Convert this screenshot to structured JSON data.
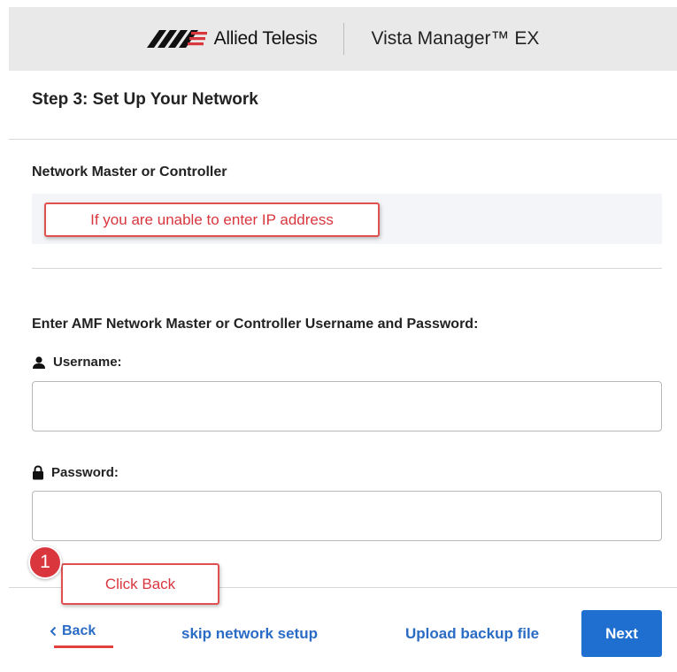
{
  "header": {
    "brand_name": "Allied Telesis",
    "product_name": "Vista Manager™ EX",
    "logo_icon": "allied-telesis-logo"
  },
  "page": {
    "step_title": "Step 3: Set Up Your Network"
  },
  "network_master": {
    "label": "Network Master or Controller"
  },
  "annotations": {
    "ip_note": "If you are unable to enter IP address",
    "click_back": "Click Back",
    "step_number": "1"
  },
  "credentials": {
    "heading": "Enter AMF Network Master or Controller Username and Password:",
    "username": {
      "label": "Username:",
      "icon": "user-icon",
      "value": "",
      "placeholder": ""
    },
    "password": {
      "label": "Password:",
      "icon": "lock-icon",
      "value": "",
      "placeholder": ""
    }
  },
  "footer": {
    "back_label": "Back",
    "skip_label": "skip network setup",
    "upload_label": "Upload backup file",
    "next_label": "Next"
  },
  "colors": {
    "link": "#2a6bc5",
    "primary_button": "#1f6fd1",
    "annotation_red": "#d9363e",
    "header_bg": "#e9e9e9"
  }
}
